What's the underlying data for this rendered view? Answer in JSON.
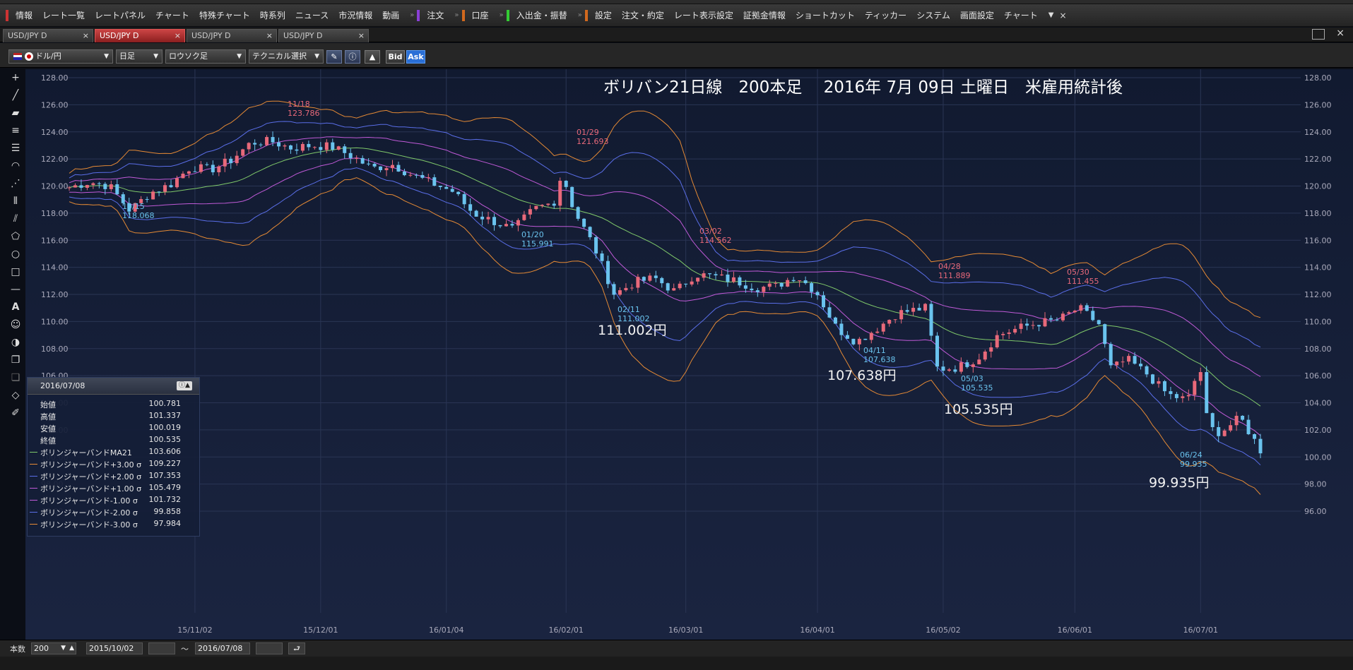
{
  "menubar": {
    "groups": [
      {
        "color": "#cc3333",
        "items": [
          "情報",
          "レート一覧",
          "レートパネル",
          "チャート",
          "特殊チャート",
          "時系列",
          "ニュース",
          "市況情報",
          "動画"
        ]
      },
      {
        "color": "#8a3fd6",
        "items": [
          "注文"
        ]
      },
      {
        "color": "#d2691e",
        "items": [
          "口座"
        ]
      },
      {
        "color": "#33cc33",
        "items": [
          "入出金・振替"
        ]
      },
      {
        "color": "#d2691e",
        "items": [
          "設定",
          "注文・約定",
          "レート表示設定",
          "証拠金情報",
          "ショートカット",
          "ティッカー",
          "システム",
          "画面設定",
          "チャート"
        ]
      }
    ],
    "more": "▼",
    "close": "×"
  },
  "tabs": [
    {
      "label": "USD/JPY D",
      "active": false,
      "close": "×"
    },
    {
      "label": "USD/JPY D",
      "active": true,
      "close": "×"
    },
    {
      "label": "USD/JPY D",
      "active": false,
      "close": "×"
    },
    {
      "label": "USD/JPY D",
      "active": false,
      "close": "×"
    }
  ],
  "toolbar": {
    "symbol": "ドル/円",
    "timeframe": "日足",
    "chart_style": "ロウソク足",
    "technical": "テクニカル選択",
    "bid_label": "Bid",
    "ask_label": "Ask"
  },
  "headline": "ボリバン21日線　200本足　 2016年 7月 09日 土曜日　米雇用統計後",
  "info": {
    "date": "2016/07/08",
    "rows": [
      {
        "label": "始値",
        "value": "100.781",
        "color": ""
      },
      {
        "label": "高値",
        "value": "101.337",
        "color": ""
      },
      {
        "label": "安値",
        "value": "100.019",
        "color": ""
      },
      {
        "label": "終値",
        "value": "100.535",
        "color": ""
      },
      {
        "label": "ボリンジャーバンドMA21",
        "value": "103.606",
        "color": "#7fc86a"
      },
      {
        "label": "ボリンジャーバンド+3.00 σ",
        "value": "109.227",
        "color": "#e58a35"
      },
      {
        "label": "ボリンジャーバンド+2.00 σ",
        "value": "107.353",
        "color": "#5a6ee8"
      },
      {
        "label": "ボリンジャーバンド+1.00 σ",
        "value": "105.479",
        "color": "#c05ad8"
      },
      {
        "label": "ボリンジャーバンド-1.00 σ",
        "value": "101.732",
        "color": "#c05ad8"
      },
      {
        "label": "ボリンジャーバンド-2.00 σ",
        "value": "99.858",
        "color": "#5a6ee8"
      },
      {
        "label": "ボリンジャーバンド-3.00 σ",
        "value": "97.984",
        "color": "#e58a35"
      }
    ]
  },
  "bottom": {
    "count_label": "本数",
    "count_value": "200",
    "start_date": "2015/10/02",
    "tilde": "～",
    "end_date": "2016/07/08"
  },
  "chart_data": {
    "type": "candlestick",
    "ylim": [
      95,
      129
    ],
    "y_ticks": [
      "128.00",
      "126.00",
      "124.00",
      "122.00",
      "120.00",
      "118.00",
      "116.00",
      "114.00",
      "112.00",
      "110.00",
      "108.00",
      "106.00",
      "104.00",
      "102.00",
      "100.00",
      "98.00",
      "96.00"
    ],
    "x_labels": [
      "15/11/02",
      "15/12/01",
      "16/01/04",
      "16/02/01",
      "16/03/01",
      "16/04/01",
      "16/05/02",
      "16/06/01",
      "16/07/01"
    ],
    "bars": 200,
    "up_color": "#e8697a",
    "down_color": "#6ac3ee",
    "highs": [
      {
        "date": "11/18",
        "value": "123.786"
      },
      {
        "date": "01/29",
        "value": "121.693"
      },
      {
        "date": "03/02",
        "value": "114.562"
      },
      {
        "date": "04/28",
        "value": "111.889"
      },
      {
        "date": "05/30",
        "value": "111.455"
      }
    ],
    "lows": [
      {
        "date": "10/15",
        "value": "118.068"
      },
      {
        "date": "01/20",
        "value": "115.991"
      },
      {
        "date": "02/11",
        "value": "111.002"
      },
      {
        "date": "04/11",
        "value": "107.638"
      },
      {
        "date": "05/03",
        "value": "105.535"
      },
      {
        "date": "06/24",
        "value": "99.935"
      }
    ],
    "annotations": [
      "111.002円",
      "107.638円",
      "105.535円",
      "99.935円"
    ],
    "path_points": [
      [
        0,
        119.9
      ],
      [
        5,
        120.3
      ],
      [
        10,
        120.0
      ],
      [
        15,
        118.2
      ],
      [
        20,
        119.5
      ],
      [
        25,
        120.1
      ],
      [
        30,
        121.4
      ],
      [
        35,
        121.2
      ],
      [
        40,
        121.9
      ],
      [
        45,
        123.2
      ],
      [
        50,
        123.3
      ],
      [
        55,
        122.8
      ],
      [
        60,
        123.0
      ],
      [
        65,
        122.9
      ],
      [
        70,
        122.2
      ],
      [
        75,
        121.3
      ],
      [
        80,
        121.6
      ],
      [
        85,
        120.8
      ],
      [
        90,
        120.2
      ],
      [
        95,
        119.6
      ],
      [
        100,
        118.0
      ],
      [
        105,
        117.4
      ],
      [
        110,
        116.8
      ],
      [
        115,
        118.3
      ],
      [
        120,
        118.8
      ],
      [
        122,
        121.0
      ],
      [
        125,
        118.2
      ],
      [
        130,
        115.5
      ],
      [
        135,
        112.0
      ],
      [
        140,
        112.9
      ],
      [
        145,
        113.2
      ],
      [
        150,
        112.2
      ],
      [
        155,
        113.5
      ],
      [
        160,
        113.3
      ],
      [
        165,
        113.0
      ],
      [
        170,
        112.5
      ],
      [
        175,
        112.6
      ],
      [
        180,
        113.4
      ],
      [
        185,
        112.2
      ],
      [
        190,
        109.5
      ],
      [
        195,
        108.5
      ],
      [
        200,
        109.5
      ],
      [
        205,
        110.6
      ],
      [
        210,
        110.9
      ],
      [
        212,
        111.0
      ],
      [
        215,
        106.5
      ],
      [
        220,
        106.6
      ],
      [
        225,
        107.3
      ],
      [
        230,
        109.0
      ],
      [
        235,
        109.5
      ],
      [
        240,
        109.9
      ],
      [
        245,
        110.1
      ],
      [
        250,
        111.0
      ],
      [
        255,
        109.8
      ],
      [
        258,
        106.5
      ],
      [
        262,
        107.2
      ],
      [
        267,
        106.1
      ],
      [
        272,
        104.6
      ],
      [
        277,
        104.2
      ],
      [
        280,
        106.7
      ],
      [
        282,
        102.2
      ],
      [
        285,
        101.8
      ],
      [
        290,
        102.9
      ],
      [
        295,
        100.5
      ]
    ],
    "label_positions": {
      "note": "layout-only values are in script"
    }
  }
}
